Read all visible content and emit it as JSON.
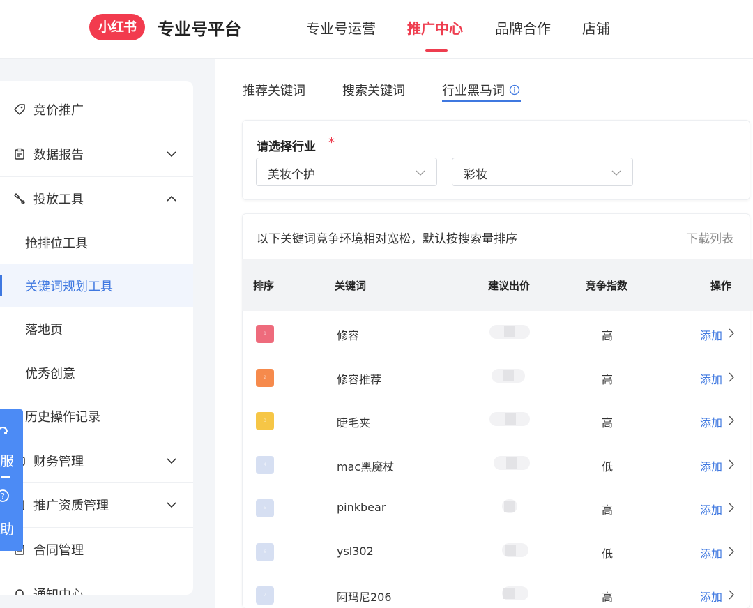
{
  "header": {
    "logo_text": "小红书",
    "platform_title": "专业号平台",
    "nav": [
      {
        "label": "专业号运营"
      },
      {
        "label": "推广中心"
      },
      {
        "label": "品牌合作"
      },
      {
        "label": "店铺"
      }
    ],
    "active_nav": "推广中心",
    "colors": {
      "brand": "#f23b4e",
      "accent": "#3f78e0"
    }
  },
  "sidebar": {
    "items": [
      {
        "label": "竞价推广",
        "icon": "tag-icon"
      },
      {
        "label": "数据报告",
        "icon": "clipboard-icon",
        "expandable": true
      },
      {
        "label": "投放工具",
        "icon": "tools-icon",
        "expanded": true
      },
      {
        "label": "抢排位工具"
      },
      {
        "label": "关键词规划工具",
        "active": true
      },
      {
        "label": "落地页"
      },
      {
        "label": "优秀创意"
      },
      {
        "label": "历史操作记录"
      },
      {
        "label": "财务管理",
        "icon": "wallet-icon",
        "expandable": true
      },
      {
        "label": "推广资质管理",
        "icon": "certificate-icon",
        "expandable": true
      },
      {
        "label": "合同管理",
        "icon": "document-icon"
      },
      {
        "label": "通知中心",
        "icon": "bell-icon"
      }
    ]
  },
  "service_widget": {
    "line1": "服",
    "line2": "助"
  },
  "tabs": [
    {
      "label": "推荐关键词"
    },
    {
      "label": "搜索关键词"
    },
    {
      "label": "行业黑马词",
      "active": true
    }
  ],
  "filter": {
    "label": "请选择行业",
    "required_mark": "*",
    "industry": "美妆个护",
    "category": "彩妆"
  },
  "list": {
    "tip": "以下关键词竞争环境相对宽松，默认按搜索量排序",
    "download": "下载列表",
    "columns": {
      "rank": "排序",
      "keyword": "关键词",
      "bid": "建议出价",
      "competition": "竞争指数",
      "action": "操作"
    },
    "rows": [
      {
        "rank": "1",
        "keyword": "修容",
        "competition": "高",
        "action": "添加",
        "badge_color": "#ee6b7c"
      },
      {
        "rank": "2",
        "keyword": "修容推荐",
        "competition": "高",
        "action": "添加",
        "badge_color": "#f68a4c"
      },
      {
        "rank": "3",
        "keyword": "睫毛夹",
        "competition": "高",
        "action": "添加",
        "badge_color": "#f6c646"
      },
      {
        "rank": "4",
        "keyword": "mac黑魔杖",
        "competition": "低",
        "action": "添加",
        "badge_color": "#d6dff2"
      },
      {
        "rank": "5",
        "keyword": "pinkbear",
        "competition": "高",
        "action": "添加",
        "badge_color": "#d6dff2"
      },
      {
        "rank": "6",
        "keyword": "ysl302",
        "competition": "低",
        "action": "添加",
        "badge_color": "#d6dff2"
      },
      {
        "rank": "7",
        "keyword": "阿玛尼206",
        "competition": "高",
        "action": "添加",
        "badge_color": "#d6dff2"
      }
    ]
  }
}
